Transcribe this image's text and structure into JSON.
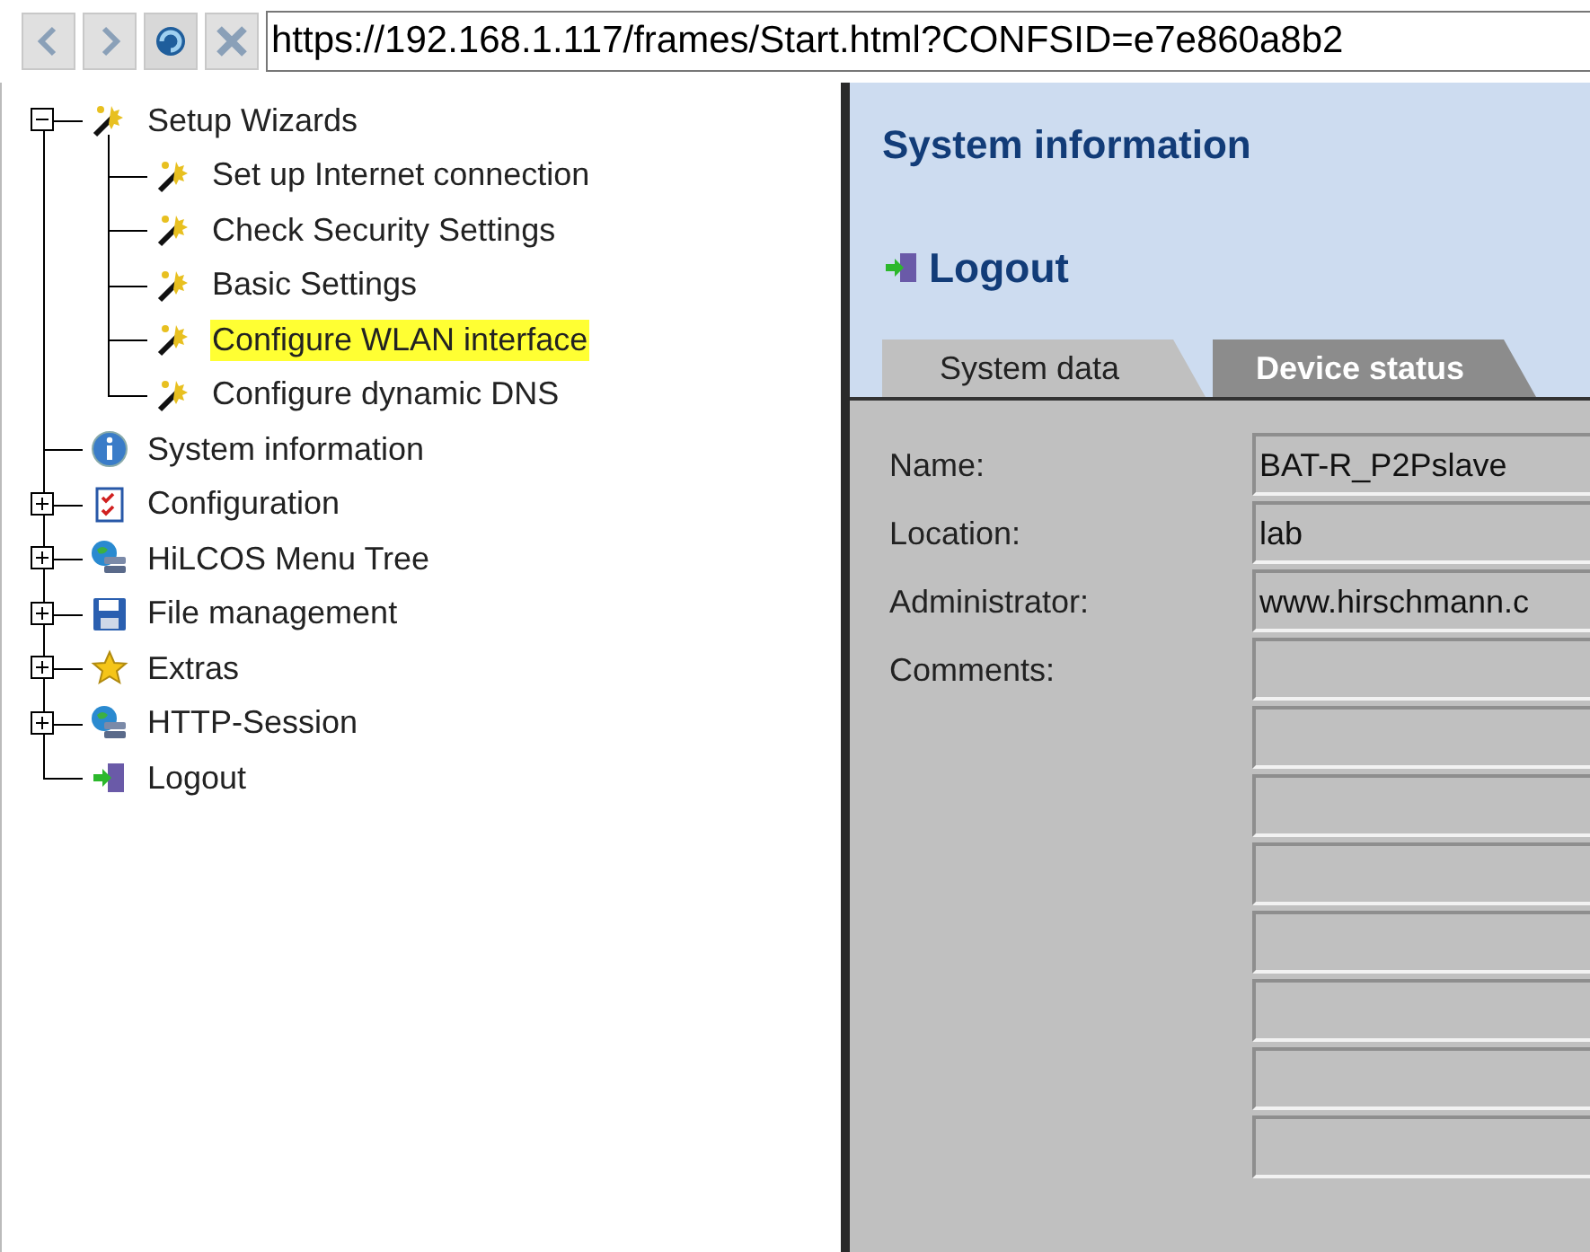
{
  "toolbar": {
    "buttons": [
      {
        "kind": "back",
        "disabled": true
      },
      {
        "kind": "forward",
        "disabled": true
      },
      {
        "kind": "reload",
        "disabled": false
      },
      {
        "kind": "stop",
        "disabled": true
      }
    ],
    "url": "https://192.168.1.117/frames/Start.html?CONFSID=e7e860a8b2"
  },
  "tree": [
    {
      "label": "Setup Wizards",
      "kind": "wand",
      "expanded": true,
      "highlighted": false,
      "children": [
        {
          "label": "Set up Internet connection",
          "kind": "wand",
          "highlighted": false
        },
        {
          "label": "Check Security Settings",
          "kind": "wand",
          "highlighted": false
        },
        {
          "label": "Basic Settings",
          "kind": "wand",
          "highlighted": false
        },
        {
          "label": "Configure WLAN interface",
          "kind": "wand",
          "highlighted": true
        },
        {
          "label": "Configure dynamic DNS",
          "kind": "wand",
          "highlighted": false
        }
      ]
    },
    {
      "label": "System information",
      "kind": "info",
      "highlighted": false
    },
    {
      "label": "Configuration",
      "kind": "checklist",
      "expanded": false,
      "highlighted": false
    },
    {
      "label": "HiLCOS Menu Tree",
      "kind": "globe",
      "expanded": false,
      "highlighted": false
    },
    {
      "label": "File management",
      "kind": "disk",
      "expanded": false,
      "highlighted": false
    },
    {
      "label": "Extras",
      "kind": "star",
      "expanded": false,
      "highlighted": false
    },
    {
      "label": "HTTP-Session",
      "kind": "globe",
      "expanded": false,
      "highlighted": false
    },
    {
      "label": "Logout",
      "kind": "logout",
      "highlighted": false
    }
  ],
  "content": {
    "title": "System information",
    "logout_link": "Logout",
    "tabs": [
      {
        "label": "System data",
        "selected": true
      },
      {
        "label": "Device status",
        "selected": false
      }
    ],
    "fields": [
      {
        "kind": "labeled",
        "label": "Name:",
        "value": "BAT-R_P2Pslave"
      },
      {
        "kind": "labeled",
        "label": "Location:",
        "value": "lab"
      },
      {
        "kind": "labeled",
        "label": "Administrator:",
        "value": "www.hirschmann.c"
      },
      {
        "kind": "labeled",
        "label": "Comments:"
      },
      {
        "kind": "continuation"
      },
      {
        "kind": "continuation"
      },
      {
        "kind": "continuation"
      },
      {
        "kind": "continuation"
      },
      {
        "kind": "continuation"
      },
      {
        "kind": "continuation"
      },
      {
        "kind": "continuation"
      }
    ]
  }
}
